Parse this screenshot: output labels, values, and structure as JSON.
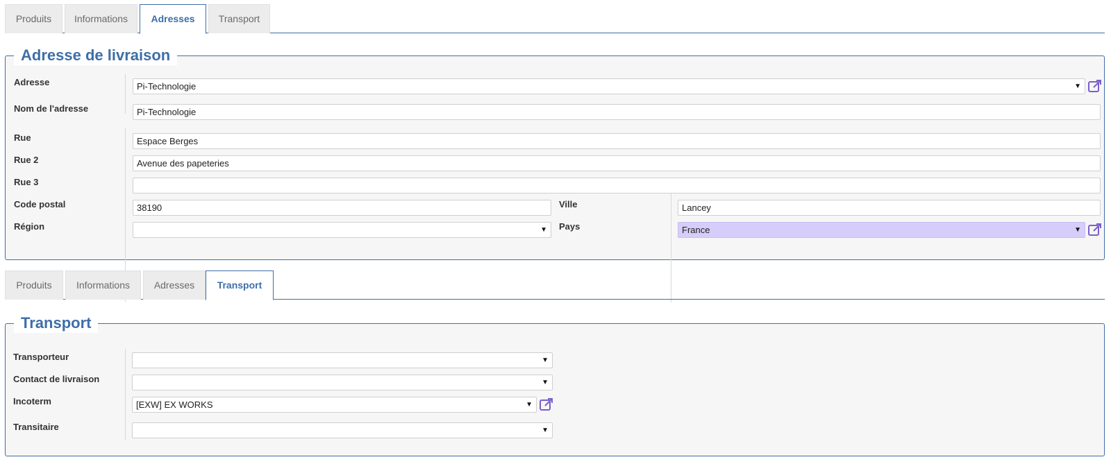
{
  "tabs_top": [
    "Produits",
    "Informations",
    "Adresses",
    "Transport"
  ],
  "tabs_bottom": [
    "Produits",
    "Informations",
    "Adresses",
    "Transport"
  ],
  "address": {
    "legend": "Adresse de livraison",
    "labels": {
      "adresse": "Adresse",
      "nom": "Nom de l'adresse",
      "rue": "Rue",
      "rue2": "Rue 2",
      "rue3": "Rue 3",
      "code_postal": "Code postal",
      "region": "Région",
      "ville": "Ville",
      "pays": "Pays"
    },
    "values": {
      "adresse": "Pi-Technologie",
      "nom": "Pi-Technologie",
      "rue": "Espace Berges",
      "rue2": "Avenue des papeteries",
      "rue3": "",
      "code_postal": "38190",
      "region": "",
      "ville": "Lancey",
      "pays": "France"
    }
  },
  "transport": {
    "legend": "Transport",
    "labels": {
      "transporteur": "Transporteur",
      "contact": "Contact de livraison",
      "incoterm": "Incoterm",
      "transitaire": "Transitaire"
    },
    "values": {
      "transporteur": "",
      "contact": "",
      "incoterm": "[EXW] EX WORKS",
      "transitaire": ""
    }
  },
  "colors": {
    "accent": "#3e6ea8",
    "highlight_field": "#d6cdfa",
    "icon": "#7b5fc7"
  },
  "icons": {
    "external_link": "external-link-icon",
    "dropdown": "chevron-down-icon"
  }
}
